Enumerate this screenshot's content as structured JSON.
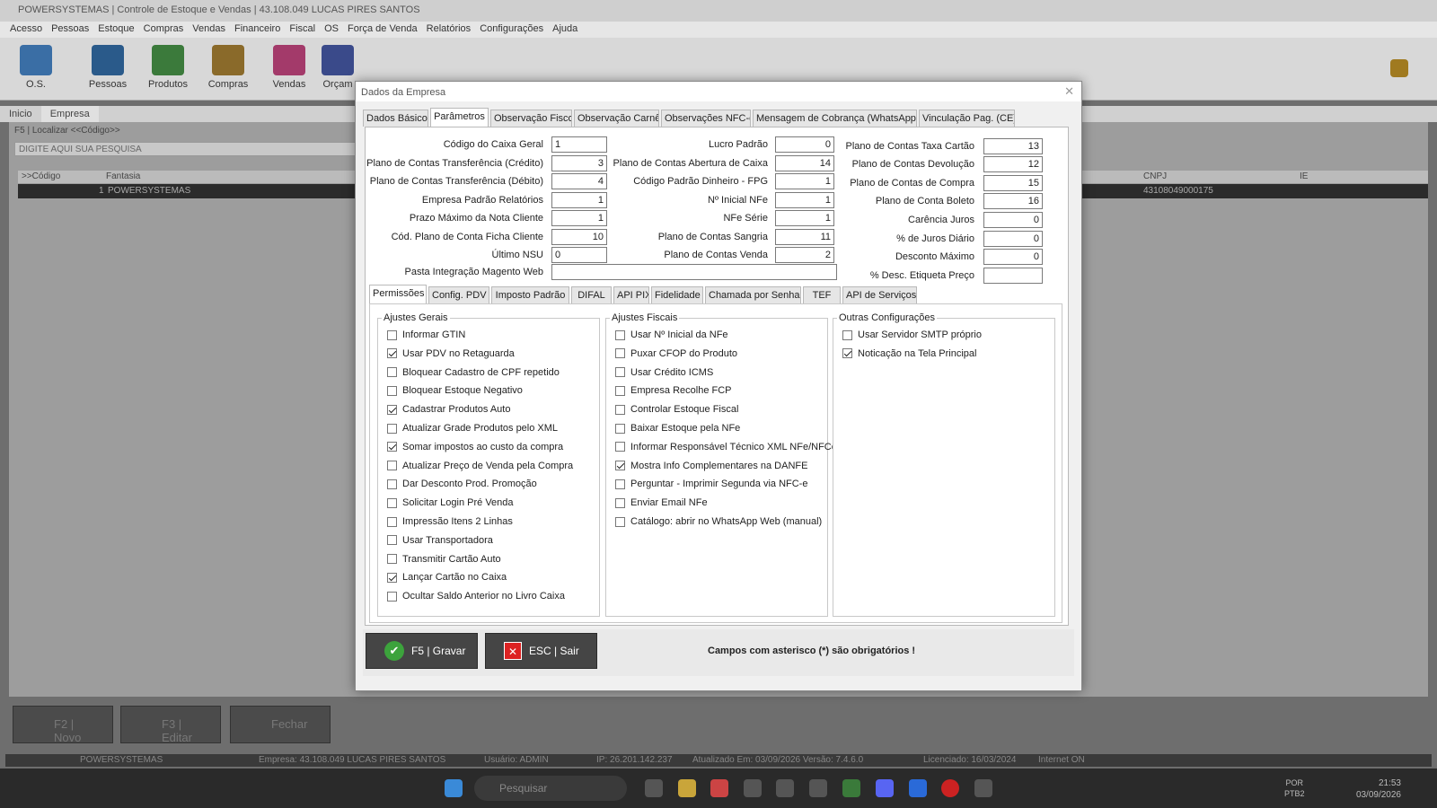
{
  "app": {
    "title": "POWERSYSTEMAS | Controle de Estoque e Vendas | 43.108.049 LUCAS PIRES SANTOS",
    "menu": [
      "Acesso",
      "Pessoas",
      "Estoque",
      "Compras",
      "Vendas",
      "Financeiro",
      "Fiscal",
      "OS",
      "Força de Venda",
      "Relatórios",
      "Configurações",
      "Ajuda"
    ],
    "toolbar": [
      "O.S.",
      "Pessoas",
      "Produtos",
      "Compras",
      "Vendas",
      "Orçam"
    ],
    "tabs": [
      "Inicio",
      "Empresa"
    ],
    "search_label": "F5 | Localizar <<Código>>",
    "search_placeholder": "DIGITE AQUI SUA PESQUISA",
    "grid_headers": {
      "code": ">>Código",
      "fantasia": "Fantasia",
      "cnpj": "CNPJ",
      "ie": "IE"
    },
    "grid_row": {
      "code": "1",
      "fantasia": "POWERSYSTEMAS",
      "cnpj": "43108049000175"
    },
    "bottom_buttons": [
      "F2 | Novo",
      "F3 | Editar",
      "Fechar"
    ],
    "status": {
      "company": "POWERSYSTEMAS",
      "empresa": "Empresa: 43.108.049 LUCAS PIRES SANTOS",
      "usuario": "Usuário: ADMIN",
      "ip": "IP: 26.201.142.237",
      "atualizado": "Atualizado Em: 03/09/2026  Versão: 7.4.6.0",
      "licenciado": "Licenciado: 16/03/2024",
      "internet": "Internet ON"
    }
  },
  "taskbar": {
    "search": "Pesquisar",
    "lang": "POR",
    "lang2": "PTB2",
    "time": "21:53",
    "date": "03/09/2026"
  },
  "dialog": {
    "title": "Dados da Empresa",
    "tabs": [
      "Dados Básico",
      "Parâmetros",
      "Observação Fisco",
      "Observação Carnê",
      "Observações NFC-e",
      "Mensagem de Cobrança (WhatsApp)",
      "Vinculação Pag. (CE)"
    ],
    "fields_col1": [
      {
        "label": "Código do Caixa Geral",
        "value": "1",
        "align": "left"
      },
      {
        "label": "Plano de Contas Transferência (Crédito)",
        "value": "3"
      },
      {
        "label": "Plano de Contas Transferência (Débito)",
        "value": "4"
      },
      {
        "label": "Empresa Padrão Relatórios",
        "value": "1"
      },
      {
        "label": "Prazo Máximo da Nota Cliente",
        "value": "1"
      },
      {
        "label": "Cód. Plano de Conta Ficha Cliente",
        "value": "10"
      },
      {
        "label": "Último NSU",
        "value": "0",
        "align": "left"
      }
    ],
    "fields_col2": [
      {
        "label": "Lucro Padrão",
        "value": "0"
      },
      {
        "label": "Plano de Contas Abertura de Caixa",
        "value": "14"
      },
      {
        "label": "Código Padrão Dinheiro - FPG",
        "value": "1"
      },
      {
        "label": "Nº Inicial NFe",
        "value": "1"
      },
      {
        "label": "NFe Série",
        "value": "1"
      },
      {
        "label": "Plano de Contas Sangria",
        "value": "11"
      },
      {
        "label": "Plano de Contas Venda",
        "value": "2"
      }
    ],
    "fields_col3": [
      {
        "label": "Plano de Contas Taxa Cartão",
        "value": "13"
      },
      {
        "label": "Plano de Contas Devolução",
        "value": "12"
      },
      {
        "label": "Plano de Contas de Compra",
        "value": "15"
      },
      {
        "label": "Plano de Conta Boleto",
        "value": "16"
      },
      {
        "label": "Carência Juros",
        "value": "0"
      },
      {
        "label": "% de Juros Diário",
        "value": "0"
      },
      {
        "label": "Desconto Máximo",
        "value": "0"
      },
      {
        "label": "% Desc. Etiqueta Preço",
        "value": ""
      }
    ],
    "magento": {
      "label": "Pasta Integração Magento Web",
      "value": ""
    },
    "subtabs": [
      "Permissões",
      "Config. PDV",
      "Imposto Padrão",
      "DIFAL",
      "API PIX",
      "Fidelidade",
      "Chamada por Senha",
      "TEF",
      "API de Serviços"
    ],
    "groups": [
      {
        "title": "Ajustes Gerais",
        "items": [
          {
            "label": "Informar GTIN",
            "checked": false
          },
          {
            "label": "Usar PDV no Retaguarda",
            "checked": true
          },
          {
            "label": "Bloquear Cadastro de CPF repetido",
            "checked": false
          },
          {
            "label": "Bloquear Estoque Negativo",
            "checked": false
          },
          {
            "label": "Cadastrar Produtos Auto",
            "checked": true
          },
          {
            "label": "Atualizar Grade Produtos pelo XML",
            "checked": false
          },
          {
            "label": "Somar impostos ao custo da compra",
            "checked": true
          },
          {
            "label": "Atualizar Preço de Venda pela Compra",
            "checked": false
          },
          {
            "label": "Dar Desconto Prod. Promoção",
            "checked": false
          },
          {
            "label": "Solicitar Login Pré Venda",
            "checked": false
          },
          {
            "label": "Impressão Itens  2 Linhas",
            "checked": false
          },
          {
            "label": "Usar Transportadora",
            "checked": false
          },
          {
            "label": "Transmitir Cartão Auto",
            "checked": false
          },
          {
            "label": "Lançar Cartão no Caixa",
            "checked": true
          },
          {
            "label": "Ocultar Saldo Anterior no Livro Caixa",
            "checked": false
          }
        ]
      },
      {
        "title": "Ajustes Fiscais",
        "items": [
          {
            "label": "Usar Nº Inicial da NFe",
            "checked": false
          },
          {
            "label": "Puxar CFOP do Produto",
            "checked": false
          },
          {
            "label": "Usar Crédito ICMS",
            "checked": false
          },
          {
            "label": "Empresa Recolhe FCP",
            "checked": false
          },
          {
            "label": "Controlar Estoque Fiscal",
            "checked": false
          },
          {
            "label": "Baixar Estoque pela NFe",
            "checked": false
          },
          {
            "label": "Informar Responsável Técnico XML NFe/NFCe",
            "checked": false
          },
          {
            "label": "Mostra Info Complementares na DANFE",
            "checked": true
          },
          {
            "label": "Perguntar - Imprimir Segunda via NFC-e",
            "checked": false
          },
          {
            "label": "Enviar Email  NFe",
            "checked": false
          },
          {
            "label": "Catálogo: abrir no WhatsApp Web (manual)",
            "checked": false
          }
        ]
      },
      {
        "title": "Outras Configurações",
        "items": [
          {
            "label": "Usar Servidor SMTP próprio",
            "checked": false
          },
          {
            "label": "Noticação na Tela Principal",
            "checked": true
          }
        ]
      }
    ],
    "buttons": {
      "save": "F5 | Gravar",
      "exit": "ESC | Sair"
    },
    "note": "Campos com asterisco (*) são obrigatórios !"
  }
}
